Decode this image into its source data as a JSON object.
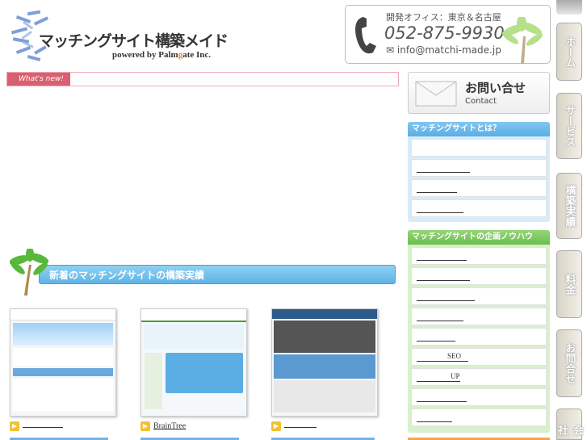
{
  "header": {
    "logo_title": "マッチングサイト構築メイド",
    "logo_sub_prefix": "powered by Palm",
    "logo_sub_g": "g",
    "logo_sub_suffix": "ate Inc.",
    "office_label": "開発オフィス：東京＆名古屋",
    "phone": "052-875-9930",
    "email": "info@matchi-made.jp"
  },
  "news": {
    "tab_label": "What's new!"
  },
  "works": {
    "heading": "新着のマッチングサイトの構築実績",
    "items": [
      {
        "caption": ""
      },
      {
        "caption": "BrainTree"
      },
      {
        "caption": ""
      }
    ]
  },
  "contact": {
    "title": "お問い合せ",
    "subtitle": "Contact"
  },
  "sidebar_about": {
    "heading": "マッチングサイトとは？",
    "items": [
      "",
      "",
      "",
      ""
    ]
  },
  "sidebar_knowhow": {
    "heading": "マッチングサイトの企画ノウハウ",
    "items": [
      "",
      "",
      "",
      "",
      "",
      "SEO",
      "UP",
      "",
      ""
    ]
  },
  "nav": {
    "tabs": [
      "ホーム",
      "サービス",
      "構築実績",
      "料金",
      "お問合せ",
      "会社"
    ]
  },
  "colors": {
    "accent_blue": "#5aaee4",
    "accent_green": "#6cbe4e",
    "accent_pink": "#d9606f"
  }
}
